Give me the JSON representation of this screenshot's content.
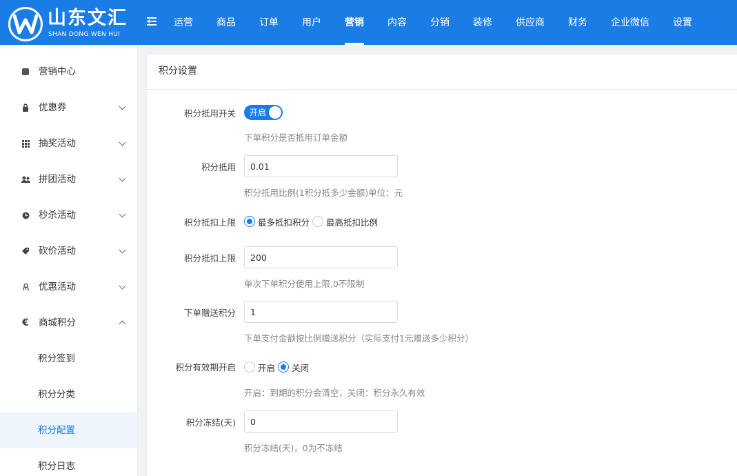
{
  "brand": {
    "title": "山东文汇",
    "subtitle": "SHAN DONG WEN HUI",
    "logo_letter": "W",
    "primary_color": "#1a7de6"
  },
  "top_nav": {
    "toggle_icon": "menu-fold-icon",
    "items": [
      {
        "label": "运营"
      },
      {
        "label": "商品"
      },
      {
        "label": "订单"
      },
      {
        "label": "用户"
      },
      {
        "label": "营销",
        "active": true
      },
      {
        "label": "内容"
      },
      {
        "label": "分销"
      },
      {
        "label": "装修"
      },
      {
        "label": "供应商"
      },
      {
        "label": "财务"
      },
      {
        "label": "企业微信"
      },
      {
        "label": "设置"
      }
    ]
  },
  "sidebar": {
    "items": [
      {
        "label": "营销中心",
        "icon": "square-icon",
        "glyph": "■"
      },
      {
        "label": "优惠券",
        "icon": "lock-icon",
        "glyph": "🔒"
      },
      {
        "label": "抽奖活动",
        "icon": "grid-icon",
        "glyph": "⠿"
      },
      {
        "label": "拼团活动",
        "icon": "group-icon",
        "glyph": "👥"
      },
      {
        "label": "秒杀活动",
        "icon": "clock-icon",
        "glyph": "◔"
      },
      {
        "label": "砍价活动",
        "icon": "tag-icon",
        "glyph": "◆"
      },
      {
        "label": "优惠活动",
        "icon": "gift-icon",
        "glyph": "✲"
      },
      {
        "label": "商城积分",
        "icon": "euro-icon",
        "glyph": "€"
      }
    ],
    "sub_items": [
      {
        "label": "积分签到"
      },
      {
        "label": "积分分类"
      },
      {
        "label": "积分配置",
        "active": true
      },
      {
        "label": "积分日志"
      }
    ]
  },
  "panel": {
    "title": "积分设置"
  },
  "form": {
    "deduct_switch": {
      "label": "积分抵用开关",
      "state_text": "开启",
      "on": true,
      "help": "下单积分是否抵用订单金额"
    },
    "deduct_ratio": {
      "label": "积分抵用",
      "value": "0.01",
      "help": "积分抵用比例(1积分抵多少金额)单位：元"
    },
    "deduct_limit_type": {
      "label": "积分抵扣上限",
      "options": [
        "最多抵扣积分",
        "最高抵扣比例"
      ],
      "selected": "最多抵扣积分"
    },
    "deduct_limit": {
      "label": "积分抵扣上限",
      "value": "200",
      "help": "单次下单积分使用上限,0不限制"
    },
    "order_gift": {
      "label": "下单赠送积分",
      "value": "1",
      "help": "下单支付金额按比例赠送积分（实际支付1元赠送多少积分）"
    },
    "expiry": {
      "label": "积分有效期开启",
      "options": [
        "开启",
        "关闭"
      ],
      "selected": "关闭",
      "help": "开启：到期的积分会清空，关闭：积分永久有效"
    },
    "freeze": {
      "label": "积分冻结(天)",
      "value": "0",
      "help": "积分冻结(天)，0为不冻结"
    }
  }
}
